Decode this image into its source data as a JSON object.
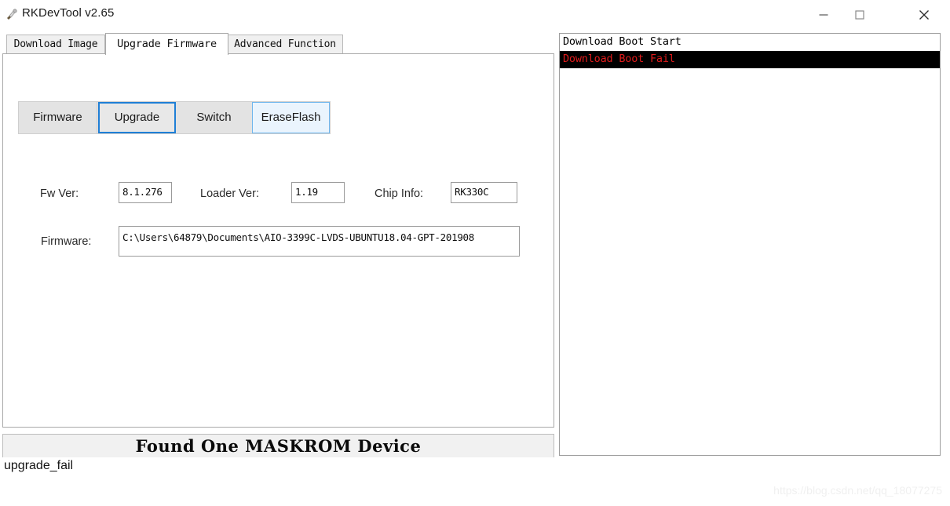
{
  "window": {
    "title": "RKDevTool v2.65",
    "icon": "app-icon",
    "controls": {
      "minimize": "minimize-icon",
      "maximize": "maximize-icon",
      "close": "close-icon"
    },
    "accent_color": "#2f8aec"
  },
  "tabs": [
    {
      "label": "Download Image",
      "active": false
    },
    {
      "label": "Upgrade Firmware",
      "active": true
    },
    {
      "label": "Advanced Function",
      "active": false
    }
  ],
  "buttons": [
    {
      "label": "Firmware",
      "state": "normal"
    },
    {
      "label": "Upgrade",
      "state": "focused",
      "border_color": "#1f7fd6"
    },
    {
      "label": "Switch",
      "state": "normal"
    },
    {
      "label": "EraseFlash",
      "state": "hover",
      "border_color": "#6fb6ee"
    }
  ],
  "fields": {
    "fw_ver": {
      "label": "Fw Ver:",
      "value": "8.1.276"
    },
    "loader_ver": {
      "label": "Loader Ver:",
      "value": "1.19"
    },
    "chip_info": {
      "label": "Chip Info:",
      "value": "RK330C"
    },
    "firmware": {
      "label": "Firmware:",
      "value": "C:\\Users\\64879\\Documents\\AIO-3399C-LVDS-UBUNTU18.04-GPT-201908"
    }
  },
  "status_bar": {
    "text": "Found One MASKROM Device"
  },
  "log": {
    "rows": [
      {
        "text": "Download Boot Start",
        "color": "#000000",
        "background": "#ffffff"
      },
      {
        "text": "Download Boot Fail",
        "color": "#e01b1b",
        "background": "#000000"
      }
    ]
  },
  "caption": "upgrade_fail",
  "watermark": "https://blog.csdn.net/qq_18077275"
}
